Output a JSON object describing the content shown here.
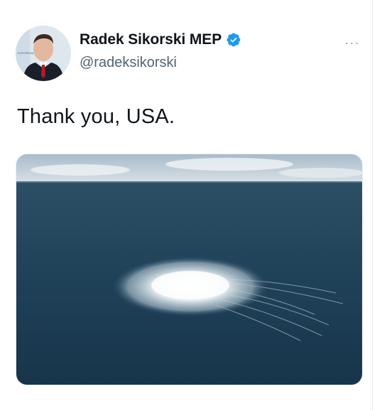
{
  "tweet": {
    "author_name": "Radek Sikorski MEP",
    "author_handle": "@radeksikorski",
    "text": "Thank you, USA.",
    "more_label": "···",
    "verified_color": "#1d9bf0"
  },
  "media": {
    "description_icon": "sea-photo",
    "sky_color": "#b8c9d4",
    "sea_color": "#1d3f56",
    "foam_color": "#f3f6f7"
  }
}
